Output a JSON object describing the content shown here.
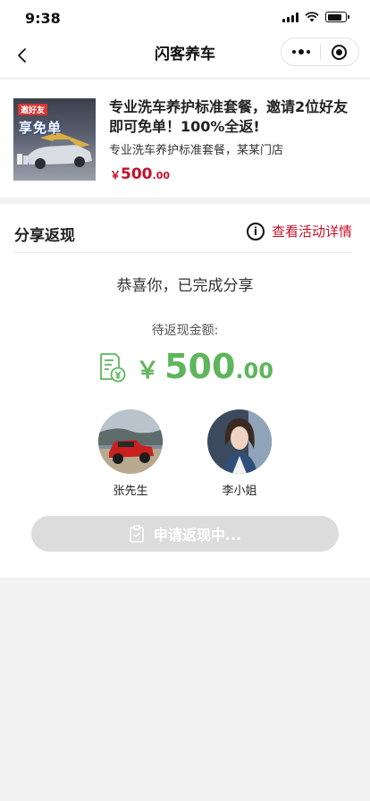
{
  "status_bar": {
    "time": "9:38"
  },
  "nav": {
    "title": "闪客养车"
  },
  "product": {
    "image_badge_top": "邀好友",
    "image_badge_main": "享免单",
    "title": "专业洗车养护标准套餐，邀请2位好友即可免单！100%全返!",
    "subtitle": "专业洗车养护标准套餐，某某门店",
    "price_currency": "￥",
    "price_int": "500",
    "price_dec": ".00"
  },
  "cashback": {
    "section_title": "分享返现",
    "details_link": "查看活动详情",
    "congrats": "恭喜你，已完成分享",
    "pending_label": "待返现金额:",
    "amount_currency": "￥",
    "amount_int": "500",
    "amount_dec": ".00",
    "friends": [
      {
        "name": "张先生",
        "avatar": "red-jeep-photo"
      },
      {
        "name": "李小姐",
        "avatar": "woman-portrait-photo"
      }
    ],
    "apply_button": "申请返现中..."
  },
  "colors": {
    "accent_red": "#c5102a",
    "amount_green": "#5fb55b",
    "button_disabled": "#dcdcdc"
  }
}
